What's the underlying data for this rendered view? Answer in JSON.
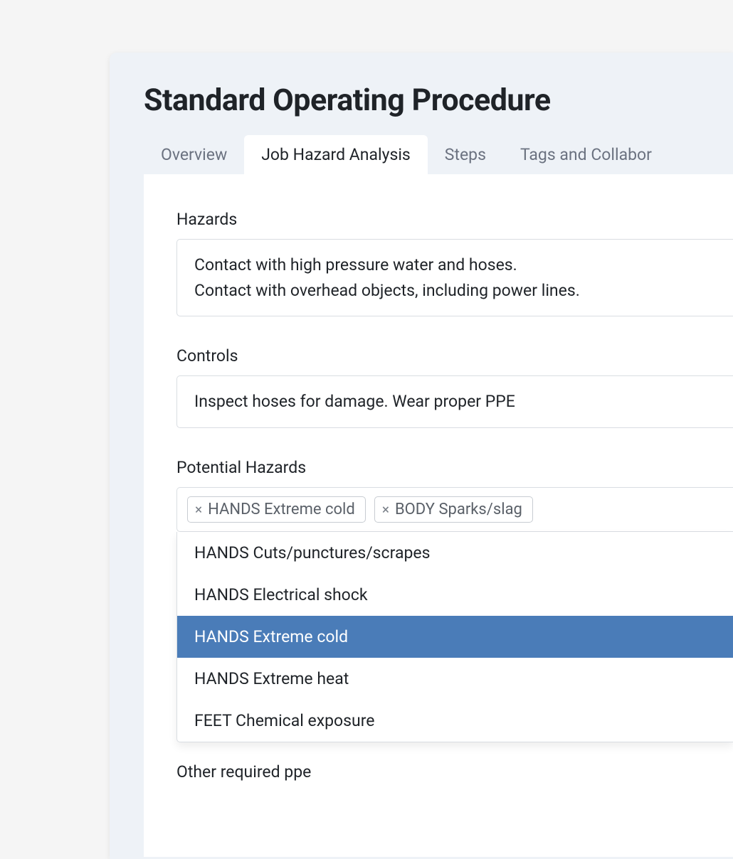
{
  "header": {
    "title": "Standard Operating Procedure"
  },
  "tabs": [
    {
      "label": "Overview",
      "active": false
    },
    {
      "label": "Job Hazard Analysis",
      "active": true
    },
    {
      "label": "Steps",
      "active": false
    },
    {
      "label": "Tags and Collabor",
      "active": false
    }
  ],
  "hazards": {
    "label": "Hazards",
    "line1": "Contact with high pressure water and hoses.",
    "line2": "Contact with overhead objects, including power lines."
  },
  "controls": {
    "label": "Controls",
    "value": "Inspect hoses for damage. Wear proper PPE"
  },
  "potential_hazards": {
    "label": "Potential Hazards",
    "selected": [
      {
        "label": "HANDS Extreme cold"
      },
      {
        "label": "BODY Sparks/slag"
      }
    ],
    "options": [
      {
        "label": "HANDS Cuts/punctures/scrapes",
        "highlighted": false
      },
      {
        "label": "HANDS Electrical shock",
        "highlighted": false
      },
      {
        "label": "HANDS Extreme cold",
        "highlighted": true
      },
      {
        "label": "HANDS Extreme heat",
        "highlighted": false
      },
      {
        "label": "FEET Chemical exposure",
        "highlighted": false
      }
    ]
  },
  "other_ppe": {
    "label": "Other required ppe"
  },
  "glyphs": {
    "x": "×"
  }
}
